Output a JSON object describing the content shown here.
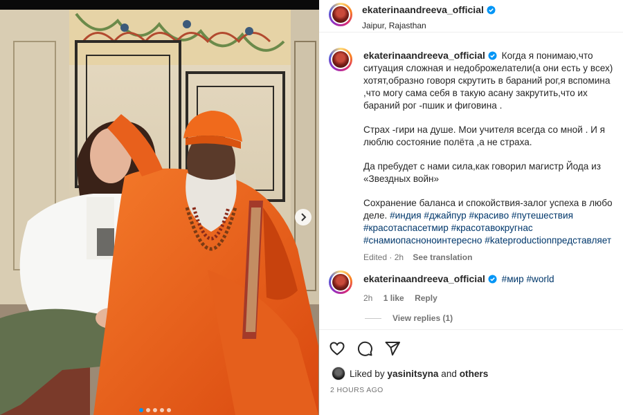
{
  "post": {
    "username": "ekaterinaandreeva_official",
    "location": "Jaipur, Rajasthan"
  },
  "caption": {
    "username": "ekaterinaandreeva_official",
    "lines": [
      "Когда я понимаю,что",
      "ситуация сложная и недоброжелатели(а они есть у всех)",
      "хотят,образно говоря скрутить в бараний рог,я вспомина",
      ",что могу сама себя в такую асану закрутить,что их",
      "бараний рог -пшик и фиговина ."
    ],
    "para2": [
      "Страх -гири на душе. Мои учителя всегда со мной . И я",
      "люблю состояние полёта ,а не страха."
    ],
    "para3": [
      "Да пребудет с нами сила,как говорил магистр Йода из",
      "«Звездных войн»"
    ],
    "para4_lines": [
      "Сохранение баланса и спокойствия-залог успеха в любо",
      "деле."
    ],
    "hashtags_line1": "#индия #джайпур #красиво #путешествия",
    "hashtags_line2": "#красотаспасетмир #красотавокругнас",
    "hashtags_line3": "#снамиопасноноинтересно #kateproductionпредставляет",
    "edited": "Edited · 2h",
    "see_translation": "See translation"
  },
  "comment": {
    "username": "ekaterinaandreeva_official",
    "text": "#мир #world",
    "time": "2h",
    "likes": "1 like",
    "reply": "Reply",
    "view_replies": "View replies (1)"
  },
  "liked_by": {
    "prefix": "Liked by",
    "user": "yasinitsyna",
    "middle": "and",
    "others": "others"
  },
  "timestamp": "2 HOURS AGO",
  "carousel": {
    "dots": 5,
    "active": 0
  },
  "icons": [
    "heart-icon",
    "comment-icon",
    "share-icon",
    "verified-icon",
    "chevron-right-icon"
  ],
  "colors": {
    "verified": "#0095f6",
    "hashtag": "#00376b",
    "muted": "#737373",
    "robe": "#e8601c"
  }
}
